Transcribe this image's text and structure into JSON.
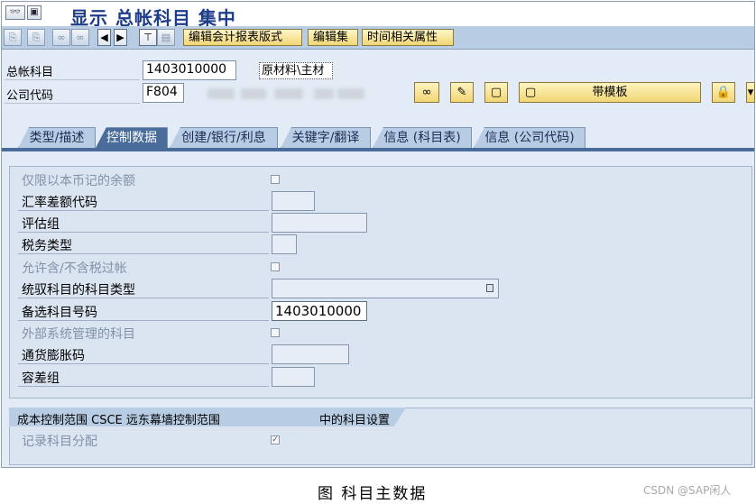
{
  "window": {
    "title": "显示 总帐科目 集中"
  },
  "toolbar": {
    "buttons": [
      "编辑会计报表版式",
      "编辑集",
      "时间相关属性"
    ]
  },
  "header": {
    "gl_account_label": "总帐科目",
    "gl_account_value": "1403010000",
    "gl_account_desc": "原材料\\主材",
    "company_code_label": "公司代码",
    "company_code_value": "F804",
    "template_button": "带模板"
  },
  "tabs": [
    {
      "label": "类型/描述",
      "active": false
    },
    {
      "label": "控制数据",
      "active": true
    },
    {
      "label": "创建/银行/利息",
      "active": false
    },
    {
      "label": "关键字/翻译",
      "active": false
    },
    {
      "label": "信息 (科目表)",
      "active": false
    },
    {
      "label": "信息 (公司代码)",
      "active": false
    }
  ],
  "control_data": {
    "only_local_currency": "仅限以本币记的余额",
    "exchange_rate_key": "汇率差额代码",
    "valuation_group": "评估组",
    "tax_category": "税务类型",
    "posting_without_tax": "允许含/不含税过帐",
    "recon_account_type": "统驭科目的科目类型",
    "alt_account_number": "备选科目号码",
    "alt_account_value": "1403010000",
    "managed_external": "外部系统管理的科目",
    "inflation_key": "通货膨胀码",
    "tolerance_group": "容差组"
  },
  "controlling_area": {
    "header_left": "成本控制范围 CSCE 远东幕墙控制范围",
    "header_right": "中的科目设置",
    "record_account_assignment": "记录科目分配"
  },
  "caption": "图  科目主数据",
  "watermark": "CSDN @SAP闲人",
  "colors": {
    "accent": "#4a6c9a",
    "tab": "#b8cce4",
    "panel": "#dbe5f1"
  }
}
